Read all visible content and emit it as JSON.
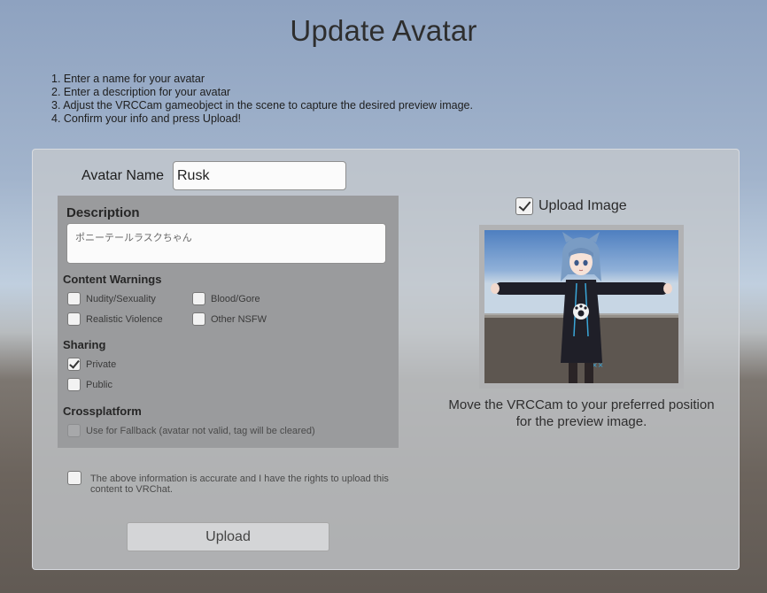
{
  "title": "Update Avatar",
  "instructions": [
    "1. Enter a name for your avatar",
    "2. Enter a description for your avatar",
    "3. Adjust the VRCCam gameobject in the scene to capture the desired preview image.",
    "4. Confirm your info and press Upload!"
  ],
  "avatar_name": {
    "label": "Avatar Name",
    "value": "Rusk"
  },
  "description": {
    "label": "Description",
    "value": "ポニーテールラスクちゃん"
  },
  "content_warnings": {
    "label": "Content Warnings",
    "items": [
      {
        "label": "Nudity/Sexuality",
        "checked": false
      },
      {
        "label": "Blood/Gore",
        "checked": false
      },
      {
        "label": "Realistic Violence",
        "checked": false
      },
      {
        "label": "Other NSFW",
        "checked": false
      }
    ]
  },
  "sharing": {
    "label": "Sharing",
    "items": [
      {
        "label": "Private",
        "checked": true
      },
      {
        "label": "Public",
        "checked": false
      }
    ]
  },
  "crossplatform": {
    "label": "Crossplatform",
    "fallback_label": "Use for Fallback (avatar not valid, tag will be cleared)",
    "fallback_checked": false
  },
  "agreement": {
    "text": "The above information is accurate and I have the rights to upload this content to VRChat.",
    "checked": false
  },
  "upload_button": "Upload",
  "upload_image": {
    "label": "Upload Image",
    "checked": true
  },
  "preview_caption": "Move the VRCCam to your preferred position for the preview image.",
  "colors": {
    "panel": "#c4c8cc",
    "desc_box": "#9a9b9d",
    "hoodie": "#1f1f28",
    "hair": "#7a9cc4",
    "accent": "#3aa6d8"
  }
}
